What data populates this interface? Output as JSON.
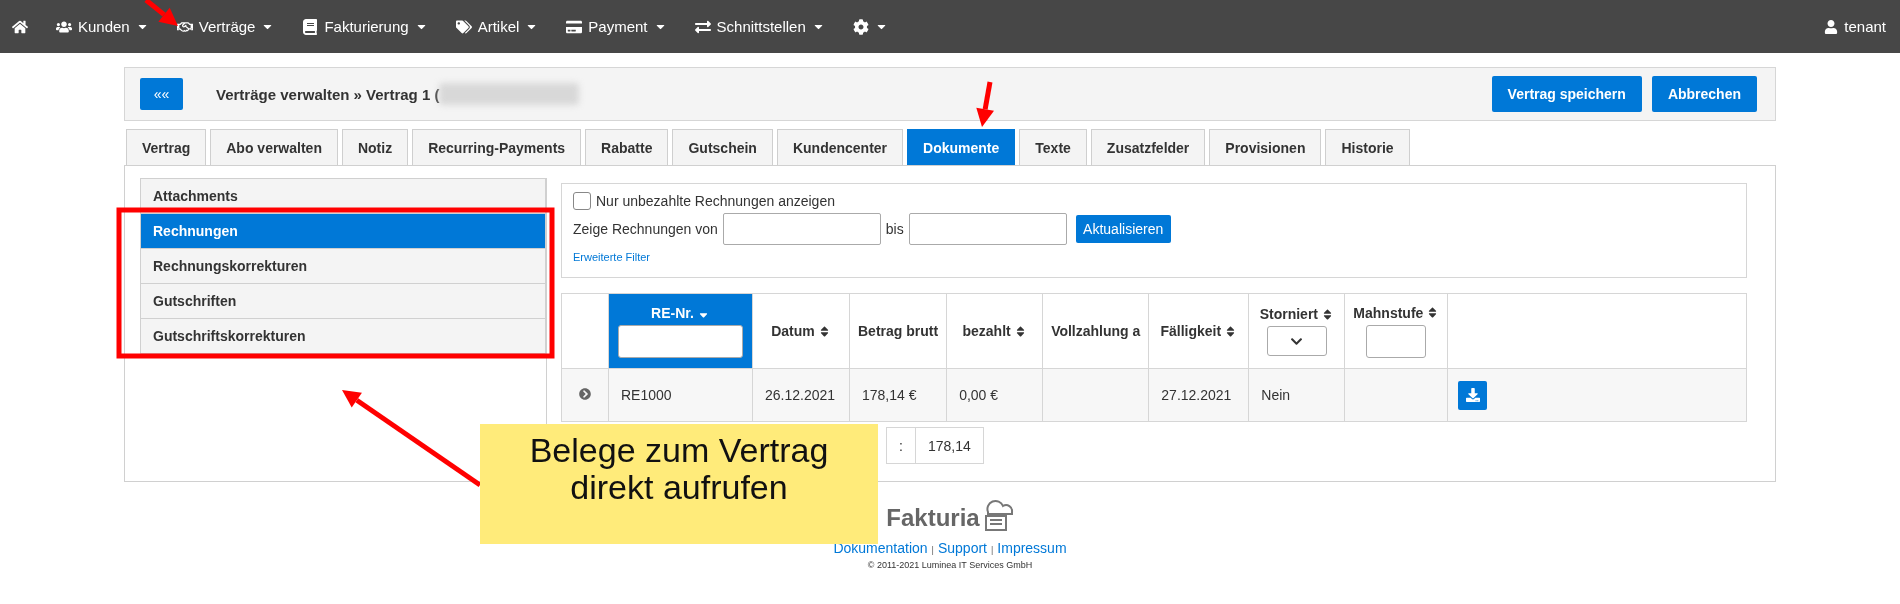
{
  "nav": {
    "items": [
      {
        "kind": "home"
      },
      {
        "kind": "menu",
        "label": "Kunden"
      },
      {
        "kind": "menu",
        "label": "Verträge"
      },
      {
        "kind": "menu",
        "label": "Fakturierung"
      },
      {
        "kind": "menu",
        "label": "Artikel"
      },
      {
        "kind": "menu",
        "label": "Payment"
      },
      {
        "kind": "menu",
        "label": "Schnittstellen"
      },
      {
        "kind": "icon-menu"
      }
    ],
    "user": "tenant"
  },
  "header": {
    "back_button": "««",
    "title": "Verträge verwalten » Vertrag 1 (",
    "buttons": [
      "Vertrag speichern",
      "Abbrechen"
    ]
  },
  "tabs": [
    {
      "label": "Vertrag",
      "selected": false
    },
    {
      "label": "Abo verwalten",
      "selected": false
    },
    {
      "label": "Notiz",
      "selected": false
    },
    {
      "label": "Recurring-Payments",
      "selected": false
    },
    {
      "label": "Rabatte",
      "selected": false
    },
    {
      "label": "Gutschein",
      "selected": false
    },
    {
      "label": "Kundencenter",
      "selected": false
    },
    {
      "label": "Dokumente",
      "selected": true
    },
    {
      "label": "Texte",
      "selected": false
    },
    {
      "label": "Zusatzfelder",
      "selected": false
    },
    {
      "label": "Provisionen",
      "selected": false
    },
    {
      "label": "Historie",
      "selected": false
    }
  ],
  "sidebar": {
    "items": [
      {
        "label": "Attachments",
        "selected": false
      },
      {
        "label": "Rechnungen",
        "selected": true
      },
      {
        "label": "Rechnungskorrekturen",
        "selected": false
      },
      {
        "label": "Gutschriften",
        "selected": false
      },
      {
        "label": "Gutschriftskorrekturen",
        "selected": false
      }
    ]
  },
  "filter": {
    "checkbox": {
      "label": "Nur unbezahlte Rechnungen anzeigen",
      "checked": false
    },
    "range_label": "Zeige Rechnungen von",
    "range_separator": "bis",
    "button": "Aktualisieren",
    "link": "Erweiterte Filter"
  },
  "table": {
    "columns": [
      {
        "label": "RE-Nr.",
        "sortable": true,
        "sorted": true,
        "filter": true,
        "dropdown": false,
        "selected": true
      },
      {
        "label": "Datum",
        "sortable": true,
        "sorted": false,
        "filter": false,
        "selected": false
      },
      {
        "label": "Betrag brutt",
        "sortable": false,
        "filter": false,
        "selected": false
      },
      {
        "label": "bezahlt",
        "sortable": true,
        "sorted": false,
        "filter": false,
        "selected": false
      },
      {
        "label": "Vollzahlung a",
        "sortable": false,
        "filter": false,
        "selected": false
      },
      {
        "label": "Fälligkeit",
        "sortable": true,
        "sorted": false,
        "filter": false,
        "selected": false
      },
      {
        "label": "Storniert",
        "sortable": true,
        "sorted": false,
        "filter": true,
        "dropdown": true,
        "selected": false
      },
      {
        "label": "Mahnstufe",
        "sortable": true,
        "sorted": false,
        "filter": true,
        "dropdown": false,
        "selected": false
      }
    ],
    "rows": [
      {
        "number": "RE1000",
        "date": "26.12.2021",
        "gross": "178,14 €",
        "paid": "0,00 €",
        "due": "27.12.2021",
        "cancelled": "Nein"
      }
    ],
    "sum": {
      "label": ":",
      "value": "178,14"
    }
  },
  "note": {
    "text": "Belege zum Vertrag\ndirekt aufrufen"
  },
  "footer": {
    "brand": "Fakturia",
    "links": [
      "Dokumentation",
      "Support",
      "Impressum"
    ],
    "separator": "|",
    "copyright": "© 2011-2021 Luminea IT Services GmbH"
  }
}
